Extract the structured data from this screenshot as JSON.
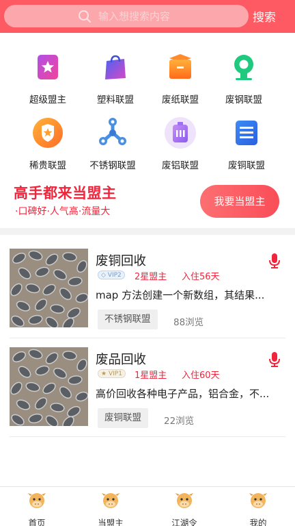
{
  "search": {
    "placeholder": "输入想搜索内容",
    "button": "搜索"
  },
  "categories": [
    {
      "label": "超级盟主",
      "icon": "star-card-icon"
    },
    {
      "label": "塑料联盟",
      "icon": "shopping-bag-icon"
    },
    {
      "label": "废纸联盟",
      "icon": "box-icon"
    },
    {
      "label": "废钢联盟",
      "icon": "location-pin-icon"
    },
    {
      "label": "稀贵联盟",
      "icon": "shield-star-icon"
    },
    {
      "label": "不锈钢联盟",
      "icon": "fidget-spinner-icon"
    },
    {
      "label": "废铝联盟",
      "icon": "briefcase-icon"
    },
    {
      "label": "废铜联盟",
      "icon": "document-icon"
    }
  ],
  "promo": {
    "title": "高手都来当盟主",
    "subtitle": "·口碑好·人气高·流量大",
    "button": "我要当盟主"
  },
  "items": [
    {
      "title": "废铜回收",
      "vip": "VIP2",
      "stars": "2星盟主",
      "since": "入住56天",
      "desc": "map 方法创建一个新数组，其结果...",
      "tag": "不锈钢联盟",
      "views": "88浏览"
    },
    {
      "title": "废品回收",
      "vip": "VIP1",
      "stars": "1星盟主",
      "since": "入住60天",
      "desc": "高价回收各种电子产品，铝合金，不...",
      "tag": "废铜联盟",
      "views": "22浏览"
    }
  ],
  "tabs": [
    {
      "label": "首页"
    },
    {
      "label": "当盟主"
    },
    {
      "label": "江湖令"
    },
    {
      "label": "我的"
    }
  ],
  "colors": {
    "brand": "#fd5a63",
    "accent_text": "#f0243a"
  }
}
